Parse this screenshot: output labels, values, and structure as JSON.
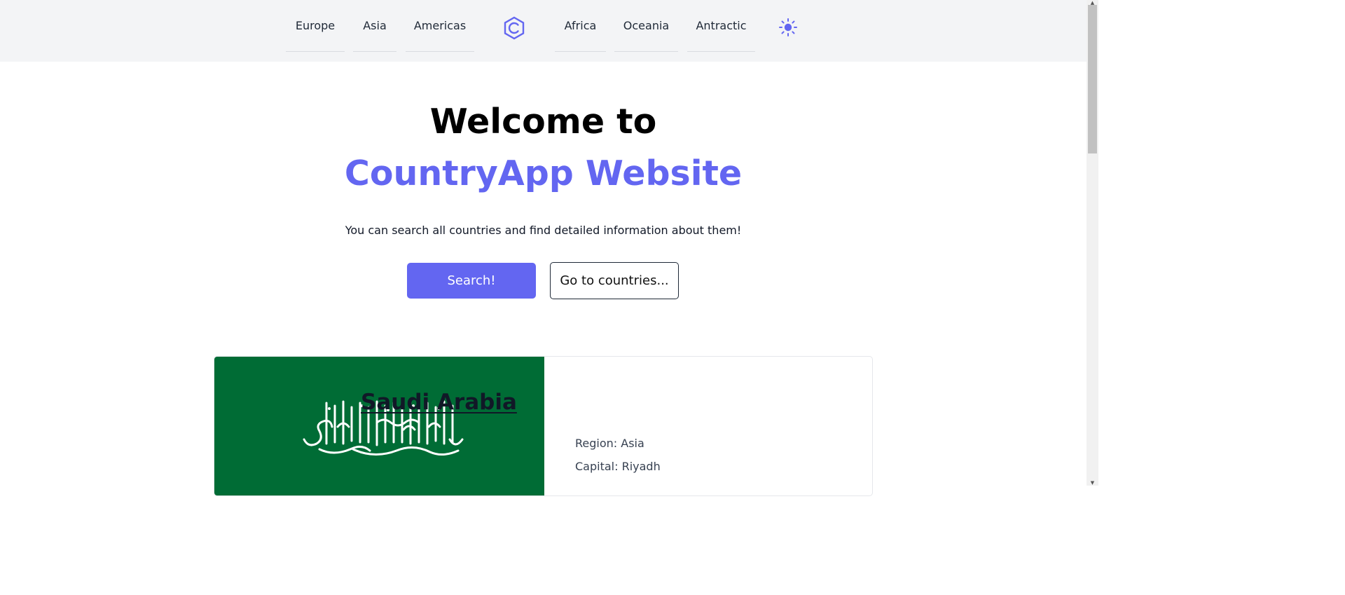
{
  "nav": {
    "left": [
      "Europe",
      "Asia",
      "Americas"
    ],
    "right": [
      "Africa",
      "Oceania",
      "Antractic"
    ],
    "logo_icon": "hexagon-c-logo-icon",
    "theme_icon": "sun-icon"
  },
  "hero": {
    "line1": "Welcome to",
    "line2": "CountryApp Website",
    "subtitle": "You can search all countries and find detailed information about them!",
    "search_button": "Search!",
    "countries_button": "Go to countries..."
  },
  "country": {
    "name": "Saudi Arabia",
    "region": "Region: Asia",
    "capital": "Capital: Riyadh",
    "flag_icon": "saudi-arabia-flag"
  },
  "colors": {
    "accent": "#6366f1",
    "nav_bg": "#f3f4f6",
    "flag_green": "#006c35"
  }
}
